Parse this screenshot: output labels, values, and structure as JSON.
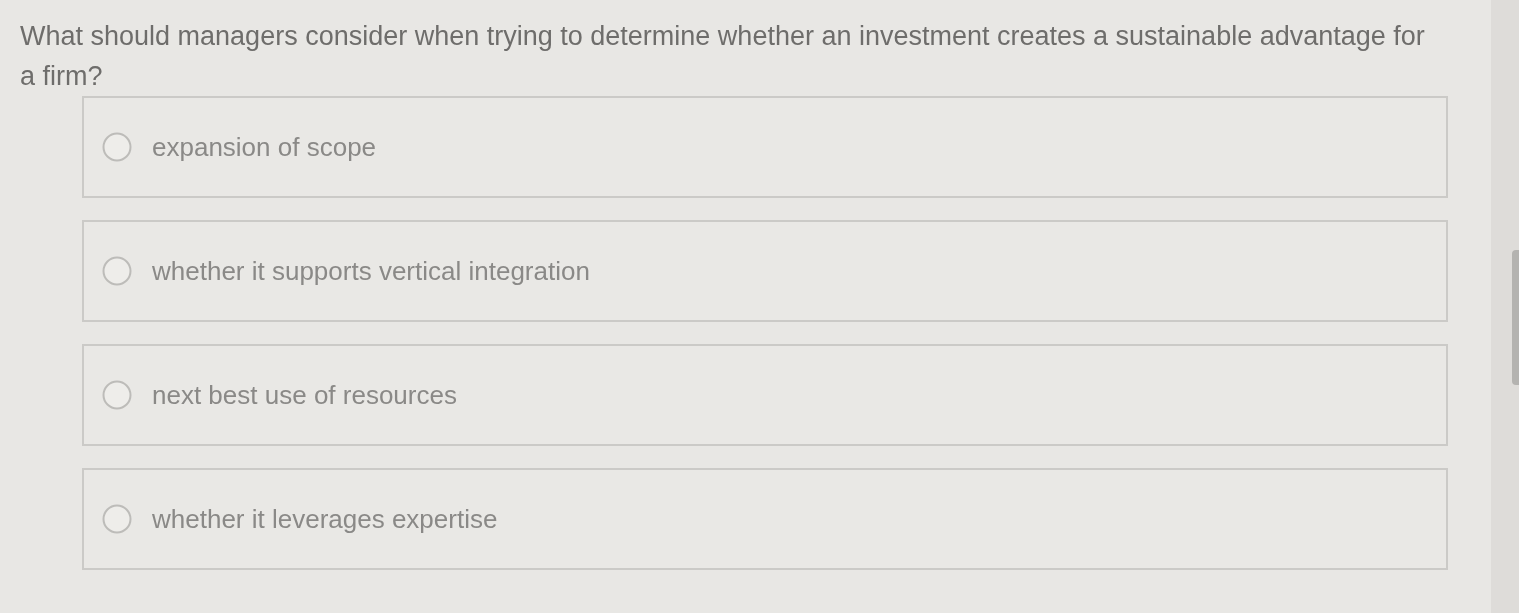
{
  "question": "What should managers consider when trying to determine whether an investment creates a sustainable advantage for a firm?",
  "options": [
    {
      "label": "expansion of scope",
      "selected": false
    },
    {
      "label": "whether it supports vertical integration",
      "selected": false
    },
    {
      "label": "next best use of resources",
      "selected": false
    },
    {
      "label": "whether it leverages expertise",
      "selected": false
    }
  ]
}
